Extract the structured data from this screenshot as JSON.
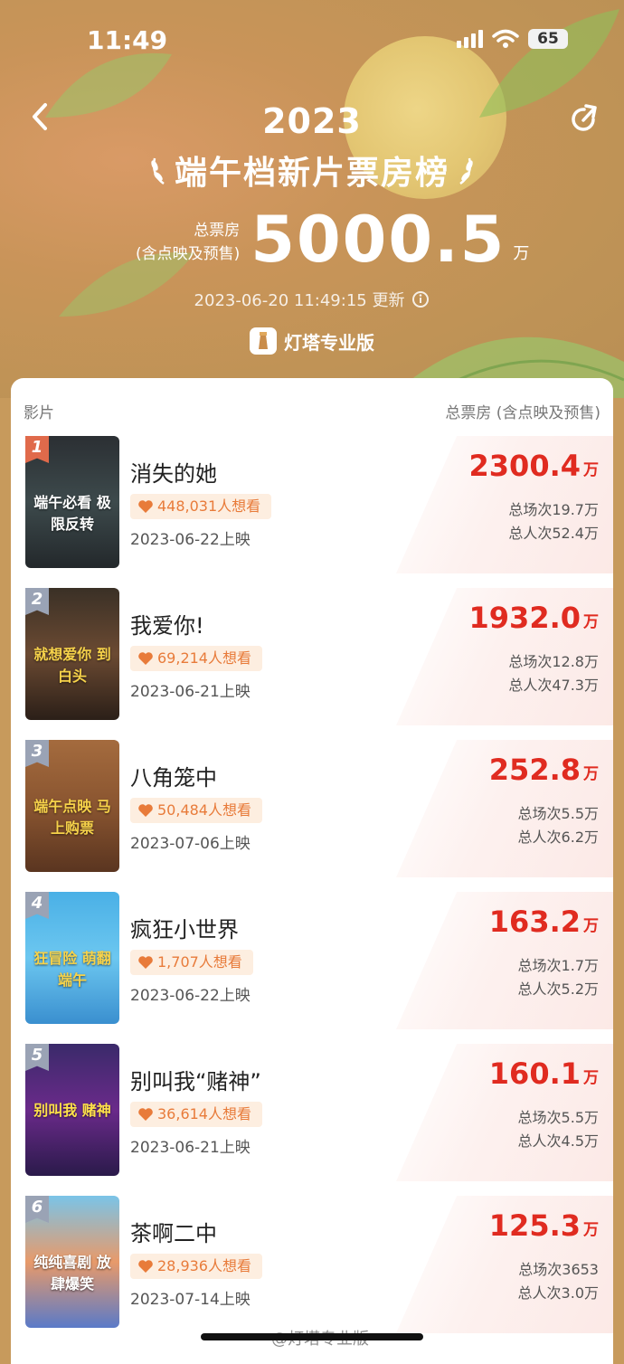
{
  "status": {
    "time": "11:49",
    "battery": "65"
  },
  "header": {
    "year": "2023",
    "title": "端午档新片票房榜",
    "total_label_1": "总票房",
    "total_label_2": "(含点映及预售)",
    "total_value": "5000.5",
    "total_unit": "万",
    "update_time": "2023-06-20 11:49:15 更新",
    "brand": "灯塔专业版"
  },
  "list": {
    "col_film": "影片",
    "col_box": "总票房 (含点映及预售)",
    "rows": [
      {
        "rank": "1",
        "name": "消失的她",
        "want": "448,031人想看",
        "date": "2023-06-22上映",
        "box": "2300.4",
        "unit": "万",
        "shows": "总场次19.7万",
        "people": "总人次52.4万",
        "poster_text": "端午必看 极限反转"
      },
      {
        "rank": "2",
        "name": "我爱你!",
        "want": "69,214人想看",
        "date": "2023-06-21上映",
        "box": "1932.0",
        "unit": "万",
        "shows": "总场次12.8万",
        "people": "总人次47.3万",
        "poster_text": "就想爱你 到白头"
      },
      {
        "rank": "3",
        "name": "八角笼中",
        "want": "50,484人想看",
        "date": "2023-07-06上映",
        "box": "252.8",
        "unit": "万",
        "shows": "总场次5.5万",
        "people": "总人次6.2万",
        "poster_text": "端午点映 马上购票"
      },
      {
        "rank": "4",
        "name": "疯狂小世界",
        "want": "1,707人想看",
        "date": "2023-06-22上映",
        "box": "163.2",
        "unit": "万",
        "shows": "总场次1.7万",
        "people": "总人次5.2万",
        "poster_text": "狂冒险 萌翻端午"
      },
      {
        "rank": "5",
        "name": "别叫我“赌神”",
        "want": "36,614人想看",
        "date": "2023-06-21上映",
        "box": "160.1",
        "unit": "万",
        "shows": "总场次5.5万",
        "people": "总人次4.5万",
        "poster_text": "别叫我 赌神"
      },
      {
        "rank": "6",
        "name": "茶啊二中",
        "want": "28,936人想看",
        "date": "2023-07-14上映",
        "box": "125.3",
        "unit": "万",
        "shows": "总场次3653",
        "people": "总人次3.0万",
        "poster_text": "纯纯喜剧 放肆爆笑"
      }
    ]
  },
  "watermark": "@灯塔专业版",
  "colors": {
    "accent_red": "#e02b20",
    "want_orange": "#e87b3a",
    "rank_1": "#e06a4b",
    "rank_other": "#9aa3b5"
  }
}
